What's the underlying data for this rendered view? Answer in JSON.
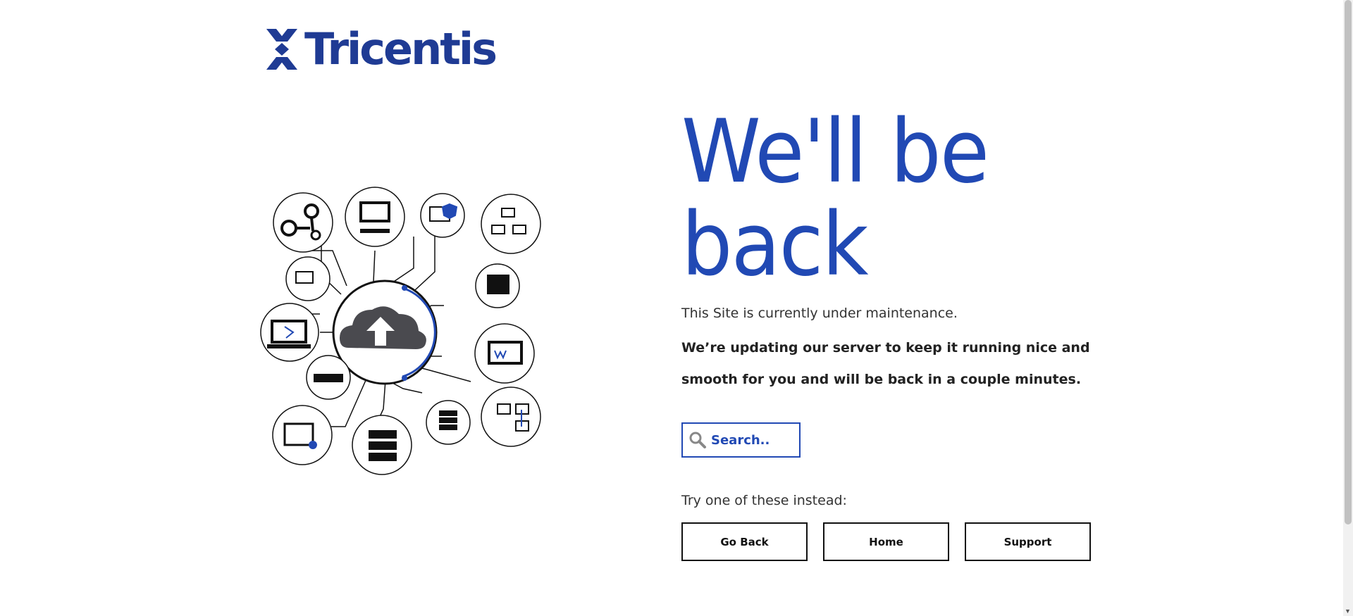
{
  "brand": {
    "name": "Tricentis",
    "color": "#1f3b94",
    "accent": "#2149b4"
  },
  "hero": {
    "headline_line1": "We'll be",
    "headline_line2": "back",
    "subtitle": "This Site is currently under maintenance.",
    "message": "We’re updating our server to keep it running nice and smooth for you and will be back in a couple minutes."
  },
  "search": {
    "placeholder": "Search..",
    "icon": "search-icon"
  },
  "alternatives": {
    "label": "Try one of these instead:",
    "buttons": [
      "Go Back",
      "Home",
      "Support"
    ]
  },
  "illustration": {
    "center_icon": "cloud-upload-icon"
  }
}
